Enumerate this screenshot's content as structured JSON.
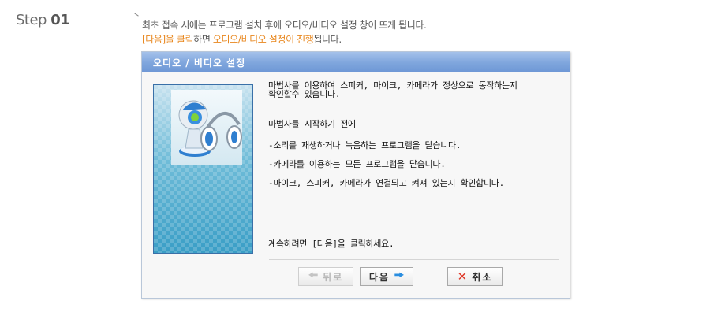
{
  "step": {
    "prefix": "Step",
    "number": "01"
  },
  "instructions": {
    "line1": "최초 접속 시에는 프로그램 설치 후에 오디오/비디오 설정 창이 뜨게 됩니다.",
    "line2_part1": "[다음]을 클릭",
    "line2_part2": "하면 ",
    "line2_part3": "오디오/비디오 설정이 진행",
    "line2_part4": "됩니다."
  },
  "dialog": {
    "title": "오디오 / 비디오 설정",
    "paragraph1_line1": "마법사를 이용하여 스피커, 마이크, 카메라가 정상으로 동작하는지",
    "paragraph1_line2": "확인할수 있습니다.",
    "intro": "마법사를 시작하기 전에",
    "bullets": [
      "-소리를 재생하거나 녹음하는 프로그램을 닫습니다.",
      "-카메라를 이용하는 모든 프로그램을 닫습니다.",
      "-마이크, 스피커, 카메라가 연결되고 켜져 있는지 확인합니다."
    ],
    "continue_text": "계속하려면 [다음]을 클릭하세요.",
    "buttons": {
      "back": "뒤로",
      "next": "다음",
      "cancel": "취소"
    }
  },
  "colors": {
    "accent_orange": "#e8871e",
    "titlebar_blue": "#7fa6dd",
    "next_arrow": "#2a8ee0",
    "cancel_x": "#e03a2a"
  },
  "icons": {
    "back": "arrow-left-icon",
    "next": "arrow-right-icon",
    "cancel": "close-icon",
    "illustration": "webcam-headset-illustration"
  }
}
